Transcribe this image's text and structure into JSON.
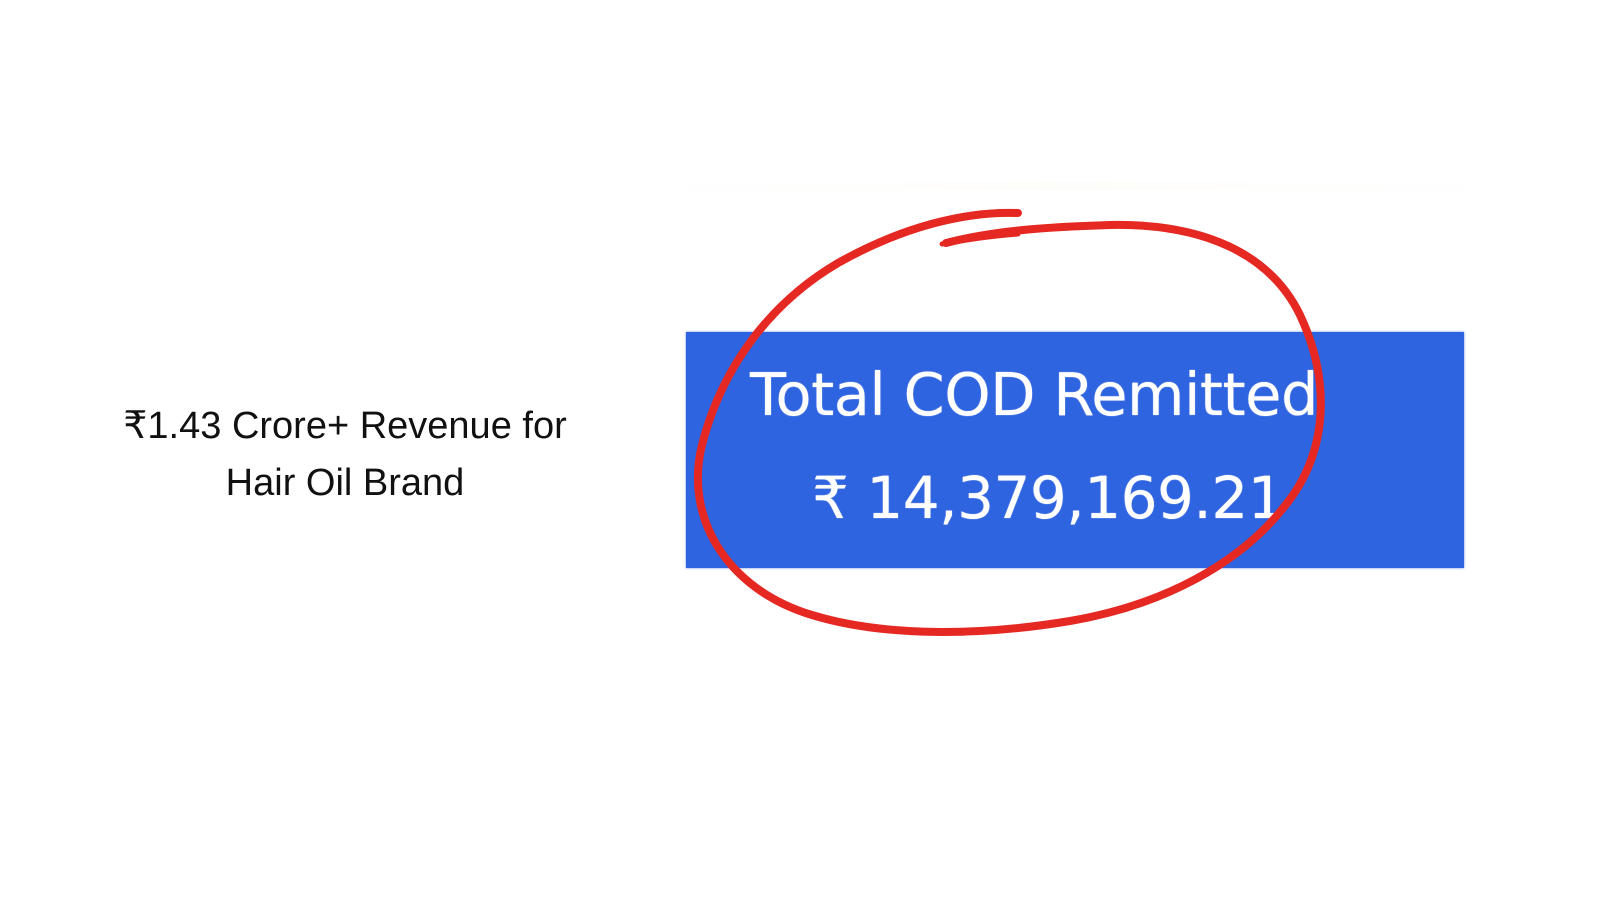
{
  "headline": {
    "line1": "₹1.43 Crore+ Revenue for",
    "line2": "Hair Oil Brand"
  },
  "cod_card": {
    "label": "Total COD Remitted",
    "amount": "₹ 14,379,169.21",
    "color": "#2f64e0"
  },
  "annotation": {
    "shape": "hand-drawn circle",
    "color": "#e52822"
  }
}
